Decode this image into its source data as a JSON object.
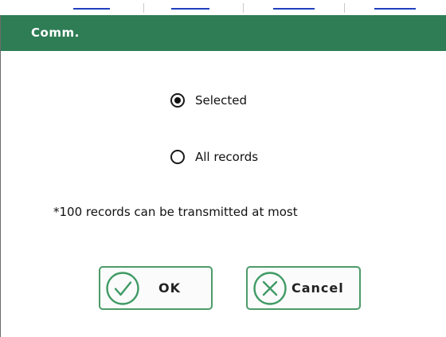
{
  "dialog": {
    "title": "Comm.",
    "options": [
      {
        "label": "Selected",
        "checked": true
      },
      {
        "label": "All records",
        "checked": false
      }
    ],
    "note": "*100 records can be transmitted at most",
    "buttons": {
      "ok_label": "OK",
      "cancel_label": "Cancel"
    }
  },
  "icons": {
    "ok": "check-circle-icon",
    "cancel": "x-circle-icon"
  },
  "colors": {
    "titlebar": "#2e7d55",
    "button_border": "#4d9b68",
    "icon_stroke": "#3f9a64"
  }
}
